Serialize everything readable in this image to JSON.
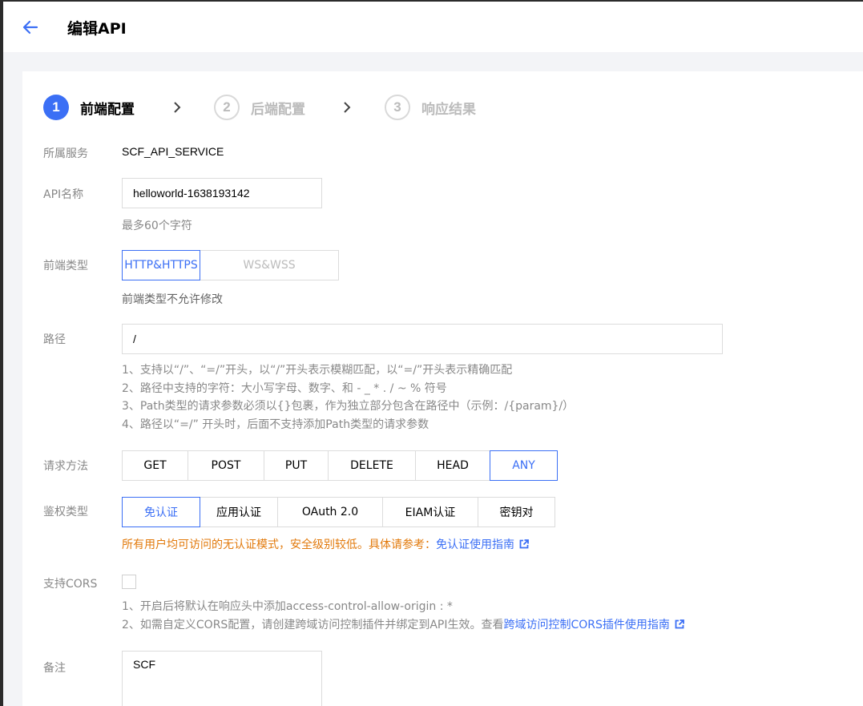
{
  "header": {
    "title": "编辑API"
  },
  "steps": [
    {
      "num": "1",
      "label": "前端配置"
    },
    {
      "num": "2",
      "label": "后端配置"
    },
    {
      "num": "3",
      "label": "响应结果"
    }
  ],
  "colors": {
    "accent": "#3b6ff5",
    "warning": "#e27a0c",
    "muted": "#888888",
    "border": "#dcdcdc"
  },
  "form": {
    "service": {
      "label": "所属服务",
      "value": "SCF_API_SERVICE"
    },
    "api_name": {
      "label": "API名称",
      "value": "helloworld-1638193142",
      "hint": "最多60个字符"
    },
    "frontend_type": {
      "label": "前端类型",
      "options": [
        "HTTP&HTTPS",
        "WS&WSS"
      ],
      "selected": "HTTP&HTTPS",
      "hint": "前端类型不允许修改"
    },
    "path": {
      "label": "路径",
      "value": "/",
      "notes": [
        "1、支持以“/”、“=/”开头，以“/”开头表示模糊匹配，以“=/”开头表示精确匹配",
        "2、路径中支持的字符：大小写字母、数字、和 - _ * . / ~ % 符号",
        "3、Path类型的请求参数必须以{}包裹，作为独立部分包含在路径中（示例：/{param}/）",
        "4、路径以“=/” 开头时，后面不支持添加Path类型的请求参数"
      ]
    },
    "method": {
      "label": "请求方法",
      "options": [
        "GET",
        "POST",
        "PUT",
        "DELETE",
        "HEAD",
        "ANY"
      ],
      "selected": "ANY"
    },
    "auth": {
      "label": "鉴权类型",
      "options": [
        "免认证",
        "应用认证",
        "OAuth 2.0",
        "EIAM认证",
        "密钥对"
      ],
      "selected": "免认证",
      "warning": "所有用户均可访问的无认证模式，安全级别较低。具体请参考：",
      "link": "免认证使用指南"
    },
    "cors": {
      "label": "支持CORS",
      "checked": false,
      "note1": "1、开启后将默认在响应头中添加access-control-allow-origin : *",
      "note2": "2、如需自定义CORS配置，请创建跨域访问控制插件并绑定到API生效。查看",
      "note2_link": "跨域访问控制CORS插件使用指南"
    },
    "remark": {
      "label": "备注",
      "value": "SCF"
    }
  }
}
